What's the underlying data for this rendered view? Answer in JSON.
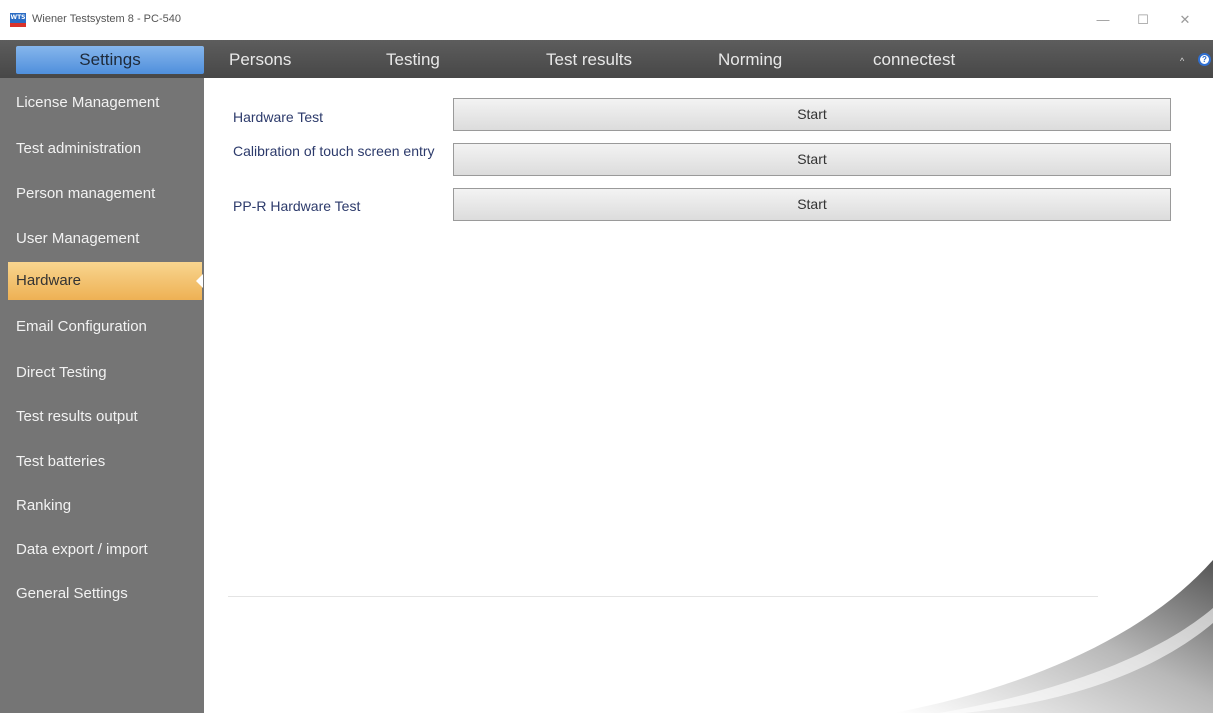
{
  "window": {
    "title": "Wiener Testsystem 8 - PC-540",
    "app_icon_text": "WTS",
    "minimize": "—",
    "maximize": "☐",
    "close": "✕"
  },
  "menu": {
    "tabs": [
      "Settings",
      "Persons",
      "Testing",
      "Test results",
      "Norming",
      "connectest"
    ],
    "active": "Settings",
    "collapse_glyph": "^",
    "help_glyph": "?"
  },
  "sidebar": {
    "items": [
      "License Management",
      "Test administration",
      "Person management",
      "User Management",
      "Hardware",
      "Email Configuration",
      "Direct Testing",
      "Test results output",
      "Test batteries",
      "Ranking",
      "Data export / import",
      "General Settings"
    ],
    "selected": "Hardware"
  },
  "hardware": {
    "rows": [
      {
        "label": "Hardware Test",
        "button": "Start"
      },
      {
        "label": "Calibration of touch screen entry",
        "button": "Start"
      },
      {
        "label": "PP-R Hardware Test",
        "button": "Start"
      }
    ]
  },
  "colors": {
    "active_tab": "#5b97de",
    "selected_item": "#f2c16e",
    "sidebar_bg": "#757575",
    "menubar_bg": "#505050",
    "label_text": "#2c3a6b"
  }
}
